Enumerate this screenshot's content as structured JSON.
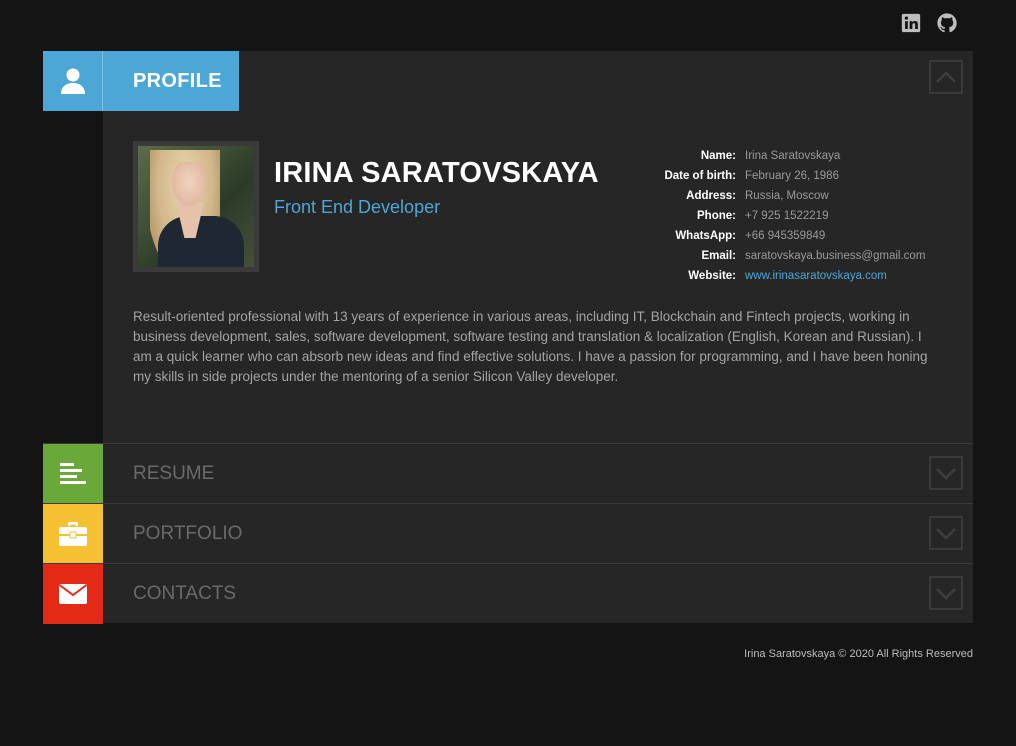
{
  "social": {
    "linkedin_icon": "linkedin-icon",
    "github_icon": "github-icon"
  },
  "colors": {
    "profile": "#4da7d6",
    "resume": "#6aa83a",
    "portfolio": "#f5c133",
    "contacts": "#e22a17",
    "background": "#141414",
    "card": "#262626"
  },
  "profile": {
    "tab_label": "PROFILE",
    "name": "IRINA SARATOVSKAYA",
    "role": "Front End Developer",
    "info": [
      {
        "key": "Name:",
        "value": "Irina Saratovskaya"
      },
      {
        "key": "Date of birth:",
        "value": "February 26, 1986"
      },
      {
        "key": "Address:",
        "value": "Russia, Moscow"
      },
      {
        "key": "Phone:",
        "value": "+7 925 1522219"
      },
      {
        "key": "WhatsApp:",
        "value": "+66 945359849"
      },
      {
        "key": "Email:",
        "value": "saratovskaya.business@gmail.com"
      },
      {
        "key": "Website:",
        "value": "www.irinasaratovskaya.com"
      }
    ],
    "summary": "Result-oriented professional with 13 years of experience in various areas, including IT, Blockchain and Fintech projects, working in business development, sales, software development, software testing and translation & localization (English, Korean and Russian). I am a quick learner who can absorb new ideas and find effective solutions. I have a passion for programming, and I have been honing my skills in side projects under the mentoring of a senior Silicon Valley developer."
  },
  "sections": [
    {
      "label": "RESUME",
      "icon": "list-icon"
    },
    {
      "label": "PORTFOLIO",
      "icon": "briefcase-icon"
    },
    {
      "label": "CONTACTS",
      "icon": "envelope-icon"
    }
  ],
  "footer": "Irina Saratovskaya © 2020 All Rights Reserved"
}
